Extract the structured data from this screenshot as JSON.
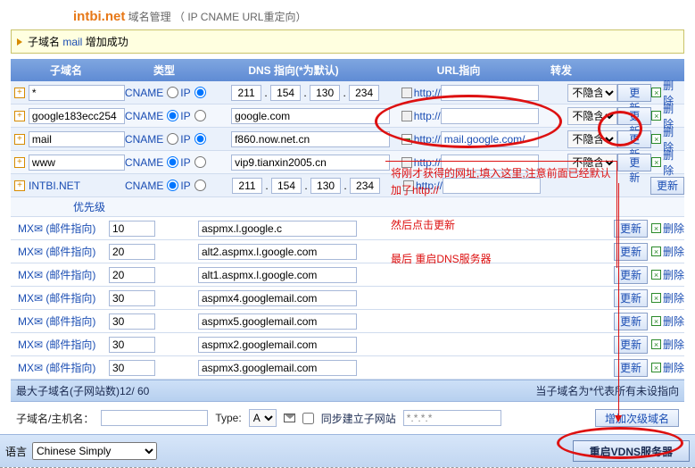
{
  "header": {
    "brand": "intbi.net",
    "suffix": " 域名管理 （ IP CNAME URL重定向）"
  },
  "notice": {
    "pre": "子域名 ",
    "mid": "mail",
    "post": " 增加成功"
  },
  "cols": {
    "sub": "子域名",
    "type": "类型",
    "dns": "DNS 指向(*为默认)",
    "url": "URL指向",
    "fw": "转发"
  },
  "labels": {
    "cname": "CNAME",
    "ip": "IP",
    "http": "http://",
    "hide": "不隐含",
    "update": "更新",
    "delete": "删除",
    "prio": "优先级",
    "mx": "MX✉ (邮件指向)",
    "stat_l": "最大子域名(子网站数)12/ 60",
    "stat_r": "当子域名为*代表所有未设指向",
    "host": "子域名/主机名：",
    "typel": "Type:",
    "sync": "同步建立子网站",
    "add": "增加次级域名",
    "lang": "语言",
    "restart": "重启VDNS服务器"
  },
  "rows": [
    {
      "sub": "*",
      "typeSel": "ip",
      "ip": [
        "211",
        "154",
        "130",
        "234"
      ],
      "dns": "",
      "url": "",
      "hide": "不隐含"
    },
    {
      "sub": "google183ecc254",
      "typeSel": "cname",
      "dns": "google.com",
      "url": "",
      "hide": "不隐含"
    },
    {
      "sub": "mail",
      "typeSel": "ip",
      "dns": "f860.now.net.cn",
      "url": "mail.google.com/",
      "hide": "不隐含",
      "hl": true
    },
    {
      "sub": "www",
      "typeSel": "cname",
      "dns": "vip9.tianxin2005.cn",
      "url": "",
      "hide": ""
    },
    {
      "sub": "INTBI.NET",
      "typeSel": "cname",
      "ip": [
        "211",
        "154",
        "130",
        "234"
      ],
      "dns": "",
      "url": "",
      "root": true
    }
  ],
  "mx": [
    {
      "pri": "10",
      "host": "aspmx.l.google.c"
    },
    {
      "pri": "20",
      "host": "alt2.aspmx.l.google.com"
    },
    {
      "pri": "20",
      "host": "alt1.aspmx.l.google.com"
    },
    {
      "pri": "30",
      "host": "aspmx4.googlemail.com"
    },
    {
      "pri": "30",
      "host": "aspmx5.googlemail.com"
    },
    {
      "pri": "30",
      "host": "aspmx2.googlemail.com"
    },
    {
      "pri": "30",
      "host": "aspmx3.googlemail.com"
    }
  ],
  "add": {
    "type": "A",
    "wild": "*.*.*.* "
  },
  "lang": {
    "value": "Chinese Simply"
  },
  "ann": {
    "l1": "将刚才获得的网址,填入这里,注意前面已经默认加了http://",
    "l2": "然后点击更新",
    "l3": "最后 重启DNS服务器"
  }
}
